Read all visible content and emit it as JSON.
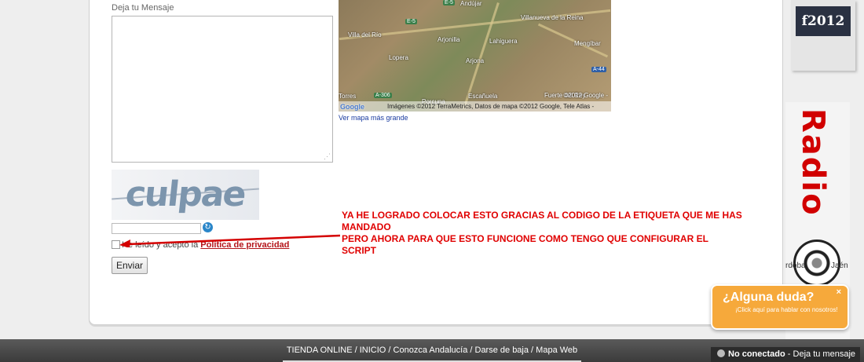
{
  "form": {
    "message_label": "Deja tu Mensaje",
    "message_value": "",
    "captcha_text": "culpae",
    "captcha_input_value": "",
    "accept_prefix": "He leído y acepto la ",
    "accept_link": "Política de privacidad",
    "submit_label": "Enviar"
  },
  "map": {
    "towns": [
      "Andújar",
      "Villanueva de la Reina",
      "Villa del Río",
      "Arjonilla",
      "Lahiguera",
      "Mengíbar",
      "Lopera",
      "Arjona",
      "Escañuela",
      "Porcuna",
      "Fuerte del Rey",
      "Torres"
    ],
    "road_shields": [
      "E-5",
      "A-44",
      "A-306",
      "E-5"
    ],
    "credit": "Imágenes ©2012 TerraMetrics, Datos de mapa ©2012 Google, Tele Atlas -",
    "credit_top": "©2012 Google -",
    "google_logo": "Google",
    "link_label": "Ver mapa más grande"
  },
  "annotation": {
    "line1": "YA HE LOGRADO COLOCAR ESTO GRACIAS AL CODIGO DE LA ETIQUETA QUE ME HAS MANDADO",
    "line2": "PERO AHORA PARA QUE ESTO FUNCIONE COMO TENGO QUE CONFIGURAR EL",
    "line3": "SCRIPT",
    "color": "#e00000"
  },
  "sidebar": {
    "ad1": "f2012",
    "ad2_word": "Radio",
    "ad2_left": "rdoba",
    "ad2_right": "Jaén"
  },
  "chat": {
    "title": "¿Alguna duda?",
    "subtitle": "¡Click aquí para hablar con nosotros!",
    "close": "×",
    "color": "#f6a93b"
  },
  "footer": {
    "links": [
      "TIENDA ONLINE",
      "INICIO",
      "Conozca Andalucía",
      "Darse de baja",
      "Mapa Web"
    ],
    "separator": " / "
  },
  "status": {
    "state": "No conectado",
    "action": "Deja tu mensaje",
    "separator": " - "
  }
}
